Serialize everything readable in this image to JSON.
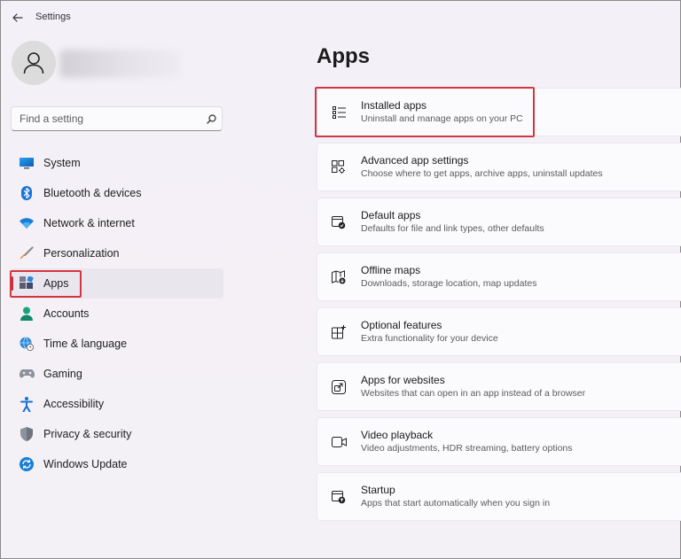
{
  "window": {
    "title": "Settings"
  },
  "search": {
    "placeholder": "Find a setting"
  },
  "sidebar": {
    "items": [
      {
        "label": "System",
        "icon": "monitor-icon"
      },
      {
        "label": "Bluetooth & devices",
        "icon": "bluetooth-icon"
      },
      {
        "label": "Network & internet",
        "icon": "wifi-icon"
      },
      {
        "label": "Personalization",
        "icon": "paintbrush-icon"
      },
      {
        "label": "Apps",
        "icon": "apps-icon",
        "selected": true
      },
      {
        "label": "Accounts",
        "icon": "person-icon"
      },
      {
        "label": "Time & language",
        "icon": "globe-clock-icon"
      },
      {
        "label": "Gaming",
        "icon": "gamepad-icon"
      },
      {
        "label": "Accessibility",
        "icon": "accessibility-icon"
      },
      {
        "label": "Privacy & security",
        "icon": "shield-icon"
      },
      {
        "label": "Windows Update",
        "icon": "update-icon"
      }
    ]
  },
  "main": {
    "title": "Apps",
    "cards": [
      {
        "title": "Installed apps",
        "subtitle": "Uninstall and manage apps on your PC",
        "icon": "list-icon"
      },
      {
        "title": "Advanced app settings",
        "subtitle": "Choose where to get apps, archive apps, uninstall updates",
        "icon": "app-settings-icon"
      },
      {
        "title": "Default apps",
        "subtitle": "Defaults for file and link types, other defaults",
        "icon": "default-apps-icon"
      },
      {
        "title": "Offline maps",
        "subtitle": "Downloads, storage location, map updates",
        "icon": "map-icon"
      },
      {
        "title": "Optional features",
        "subtitle": "Extra functionality for your device",
        "icon": "grid-plus-icon"
      },
      {
        "title": "Apps for websites",
        "subtitle": "Websites that can open in an app instead of a browser",
        "icon": "open-in-app-icon"
      },
      {
        "title": "Video playback",
        "subtitle": "Video adjustments, HDR streaming, battery options",
        "icon": "video-icon"
      },
      {
        "title": "Startup",
        "subtitle": "Apps that start automatically when you sign in",
        "icon": "startup-icon"
      }
    ]
  },
  "colors": {
    "accent": "#0067c0",
    "highlight": "#d3363f",
    "selected_bar": "#b8313a"
  }
}
